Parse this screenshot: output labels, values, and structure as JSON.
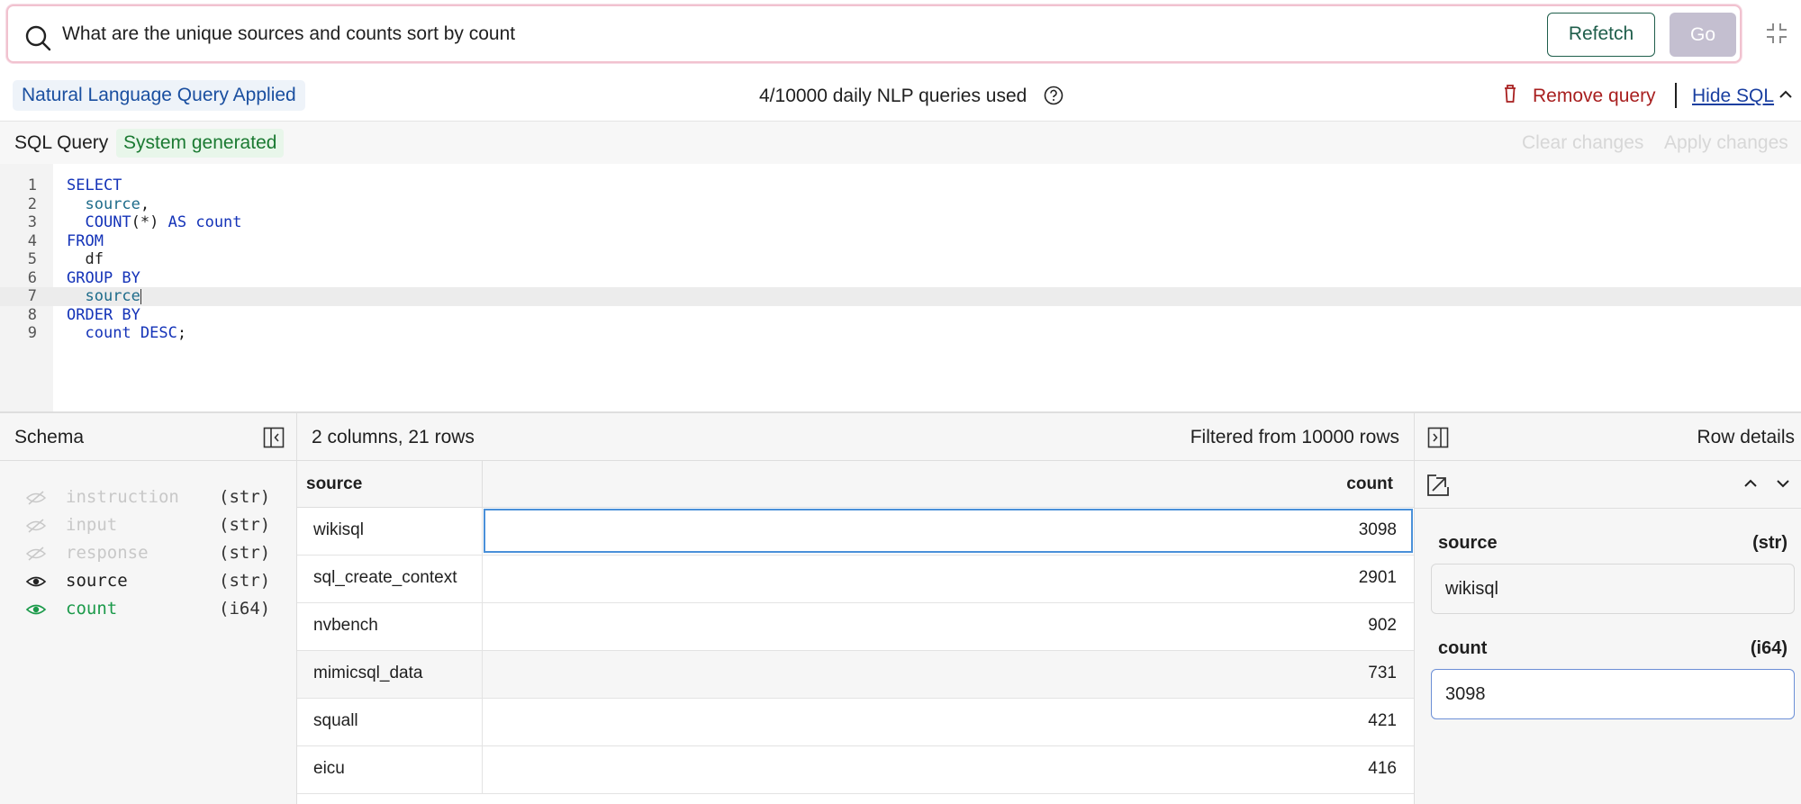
{
  "search": {
    "query": "What are the unique sources and counts sort by count",
    "refetch_label": "Refetch",
    "go_label": "Go"
  },
  "status": {
    "nlq_badge": "Natural Language Query Applied",
    "quota": "4/10000 daily NLP queries used",
    "remove_label": "Remove query",
    "hide_sql_label": "Hide SQL"
  },
  "sql": {
    "title": "SQL Query",
    "badge": "System generated",
    "clear_label": "Clear changes",
    "apply_label": "Apply changes",
    "line_numbers": [
      "1",
      "2",
      "3",
      "4",
      "5",
      "6",
      "7",
      "8",
      "9"
    ],
    "lines": {
      "l1": "SELECT",
      "l2_id": "source",
      "l2_p": ",",
      "l3_a": "COUNT",
      "l3_b": "(*)",
      "l3_c": "AS count",
      "l4": "FROM",
      "l5": "df",
      "l6": "GROUP BY",
      "l7": "source",
      "l8": "ORDER BY",
      "l9_a": "count DESC",
      "l9_b": ";"
    }
  },
  "schema": {
    "title": "Schema",
    "columns": [
      {
        "name": "instruction",
        "type": "(str)",
        "visible": false
      },
      {
        "name": "input",
        "type": "(str)",
        "visible": false
      },
      {
        "name": "response",
        "type": "(str)",
        "visible": false
      },
      {
        "name": "source",
        "type": "(str)",
        "visible": true
      },
      {
        "name": "count",
        "type": "(i64)",
        "visible": true
      }
    ]
  },
  "table": {
    "summary": "2 columns, 21 rows",
    "filtered": "Filtered from 10000 rows",
    "headers": [
      "source",
      "count"
    ],
    "rows": [
      [
        "wikisql",
        "3098"
      ],
      [
        "sql_create_context",
        "2901"
      ],
      [
        "nvbench",
        "902"
      ],
      [
        "mimicsql_data",
        "731"
      ],
      [
        "squall",
        "421"
      ],
      [
        "eicu",
        "416"
      ]
    ]
  },
  "details": {
    "title": "Row details",
    "fields": [
      {
        "label": "source",
        "type": "(str)",
        "value": "wikisql"
      },
      {
        "label": "count",
        "type": "(i64)",
        "value": "3098"
      }
    ]
  },
  "colors": {
    "accent": "#1f5e4b",
    "link": "#1a3fa0",
    "danger": "#a81f1f",
    "success": "#1b7a32",
    "selection": "#4a90d9"
  }
}
